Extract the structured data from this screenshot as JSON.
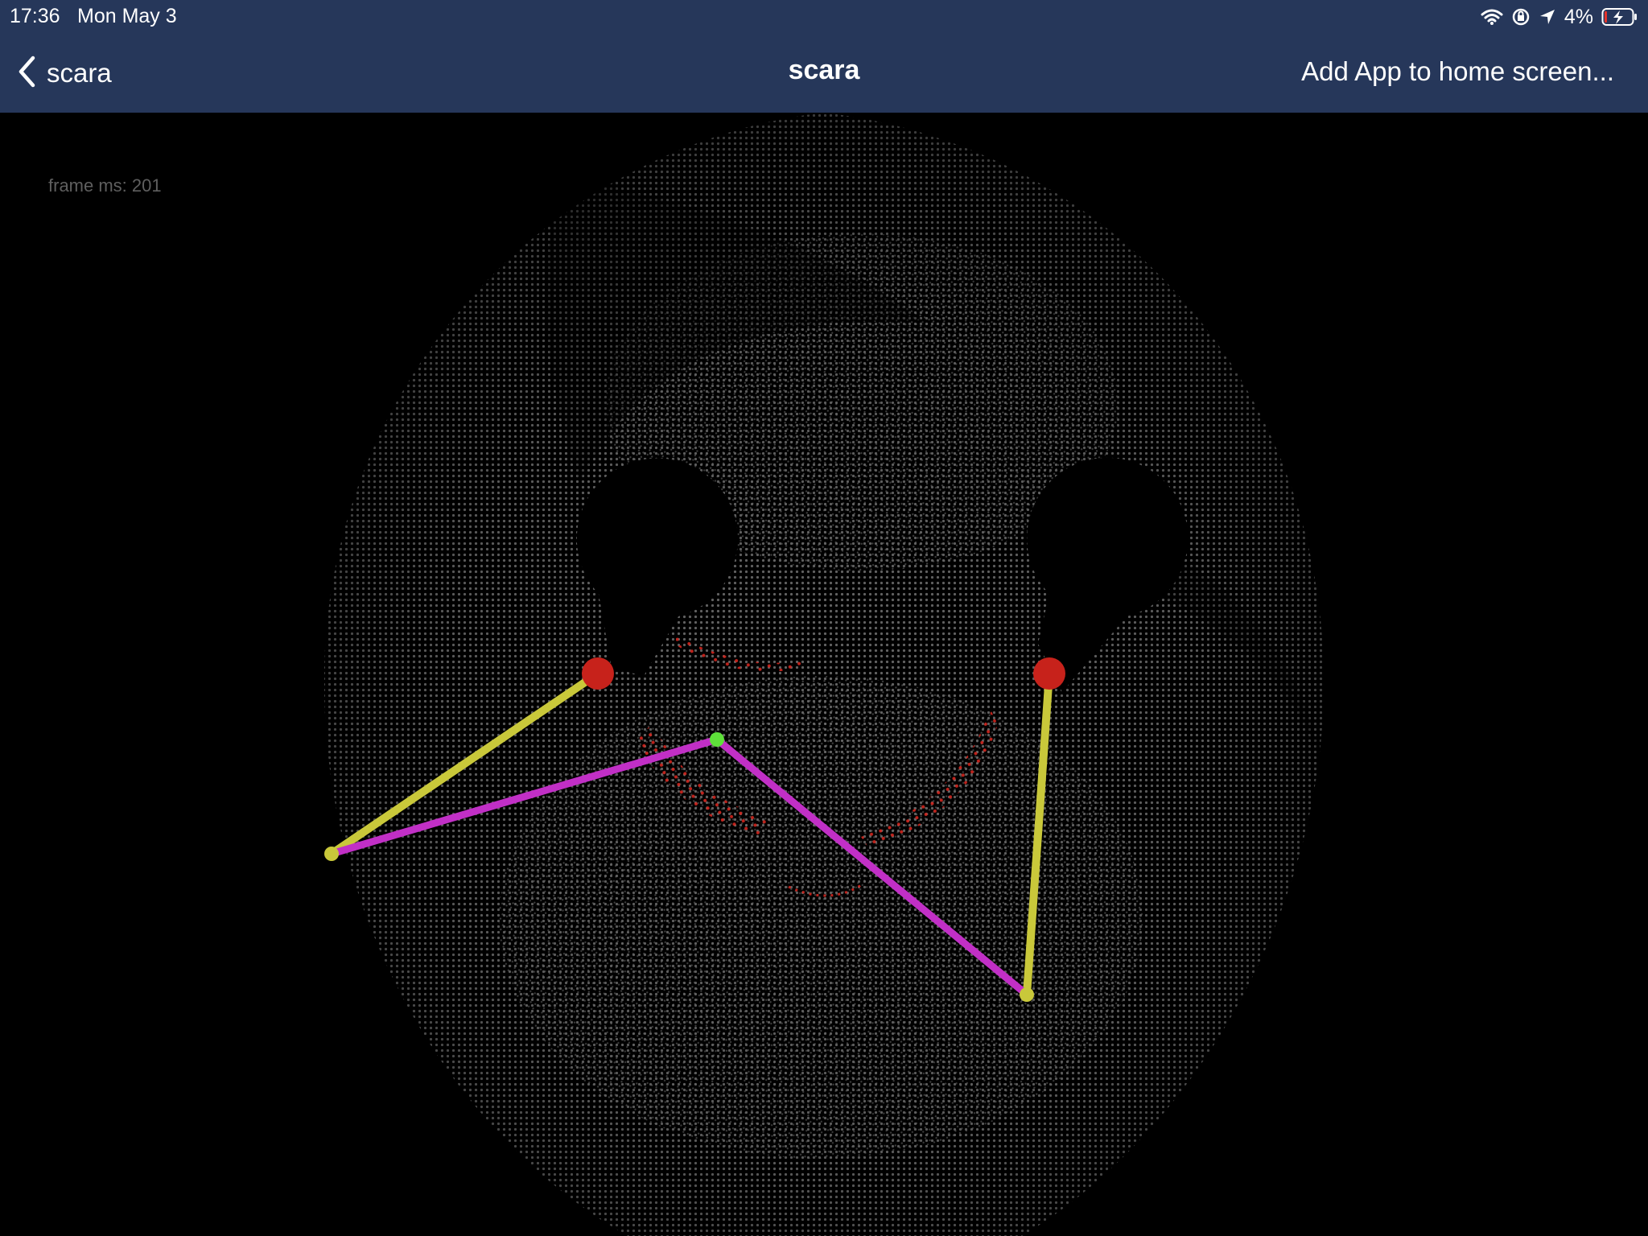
{
  "status": {
    "time": "17:36",
    "date": "Mon May 3",
    "battery": "4%",
    "icons": [
      "wifi-icon",
      "orientation-lock-icon",
      "location-arrow-icon",
      "battery-charging-icon"
    ]
  },
  "nav": {
    "back_label": "scara",
    "title": "scara",
    "action_label": "Add App to home screen..."
  },
  "canvas": {
    "frame_label": "frame ms: 201",
    "colors": {
      "background": "#000000",
      "workspace_dots": "#6a6a6a",
      "singularity_dots": "#d3261e",
      "base_joint": "#c7221b",
      "proximal_arm": "#c9c83a",
      "distal_arm": "#c12fc6",
      "end_effector": "#5ee03a"
    }
  }
}
